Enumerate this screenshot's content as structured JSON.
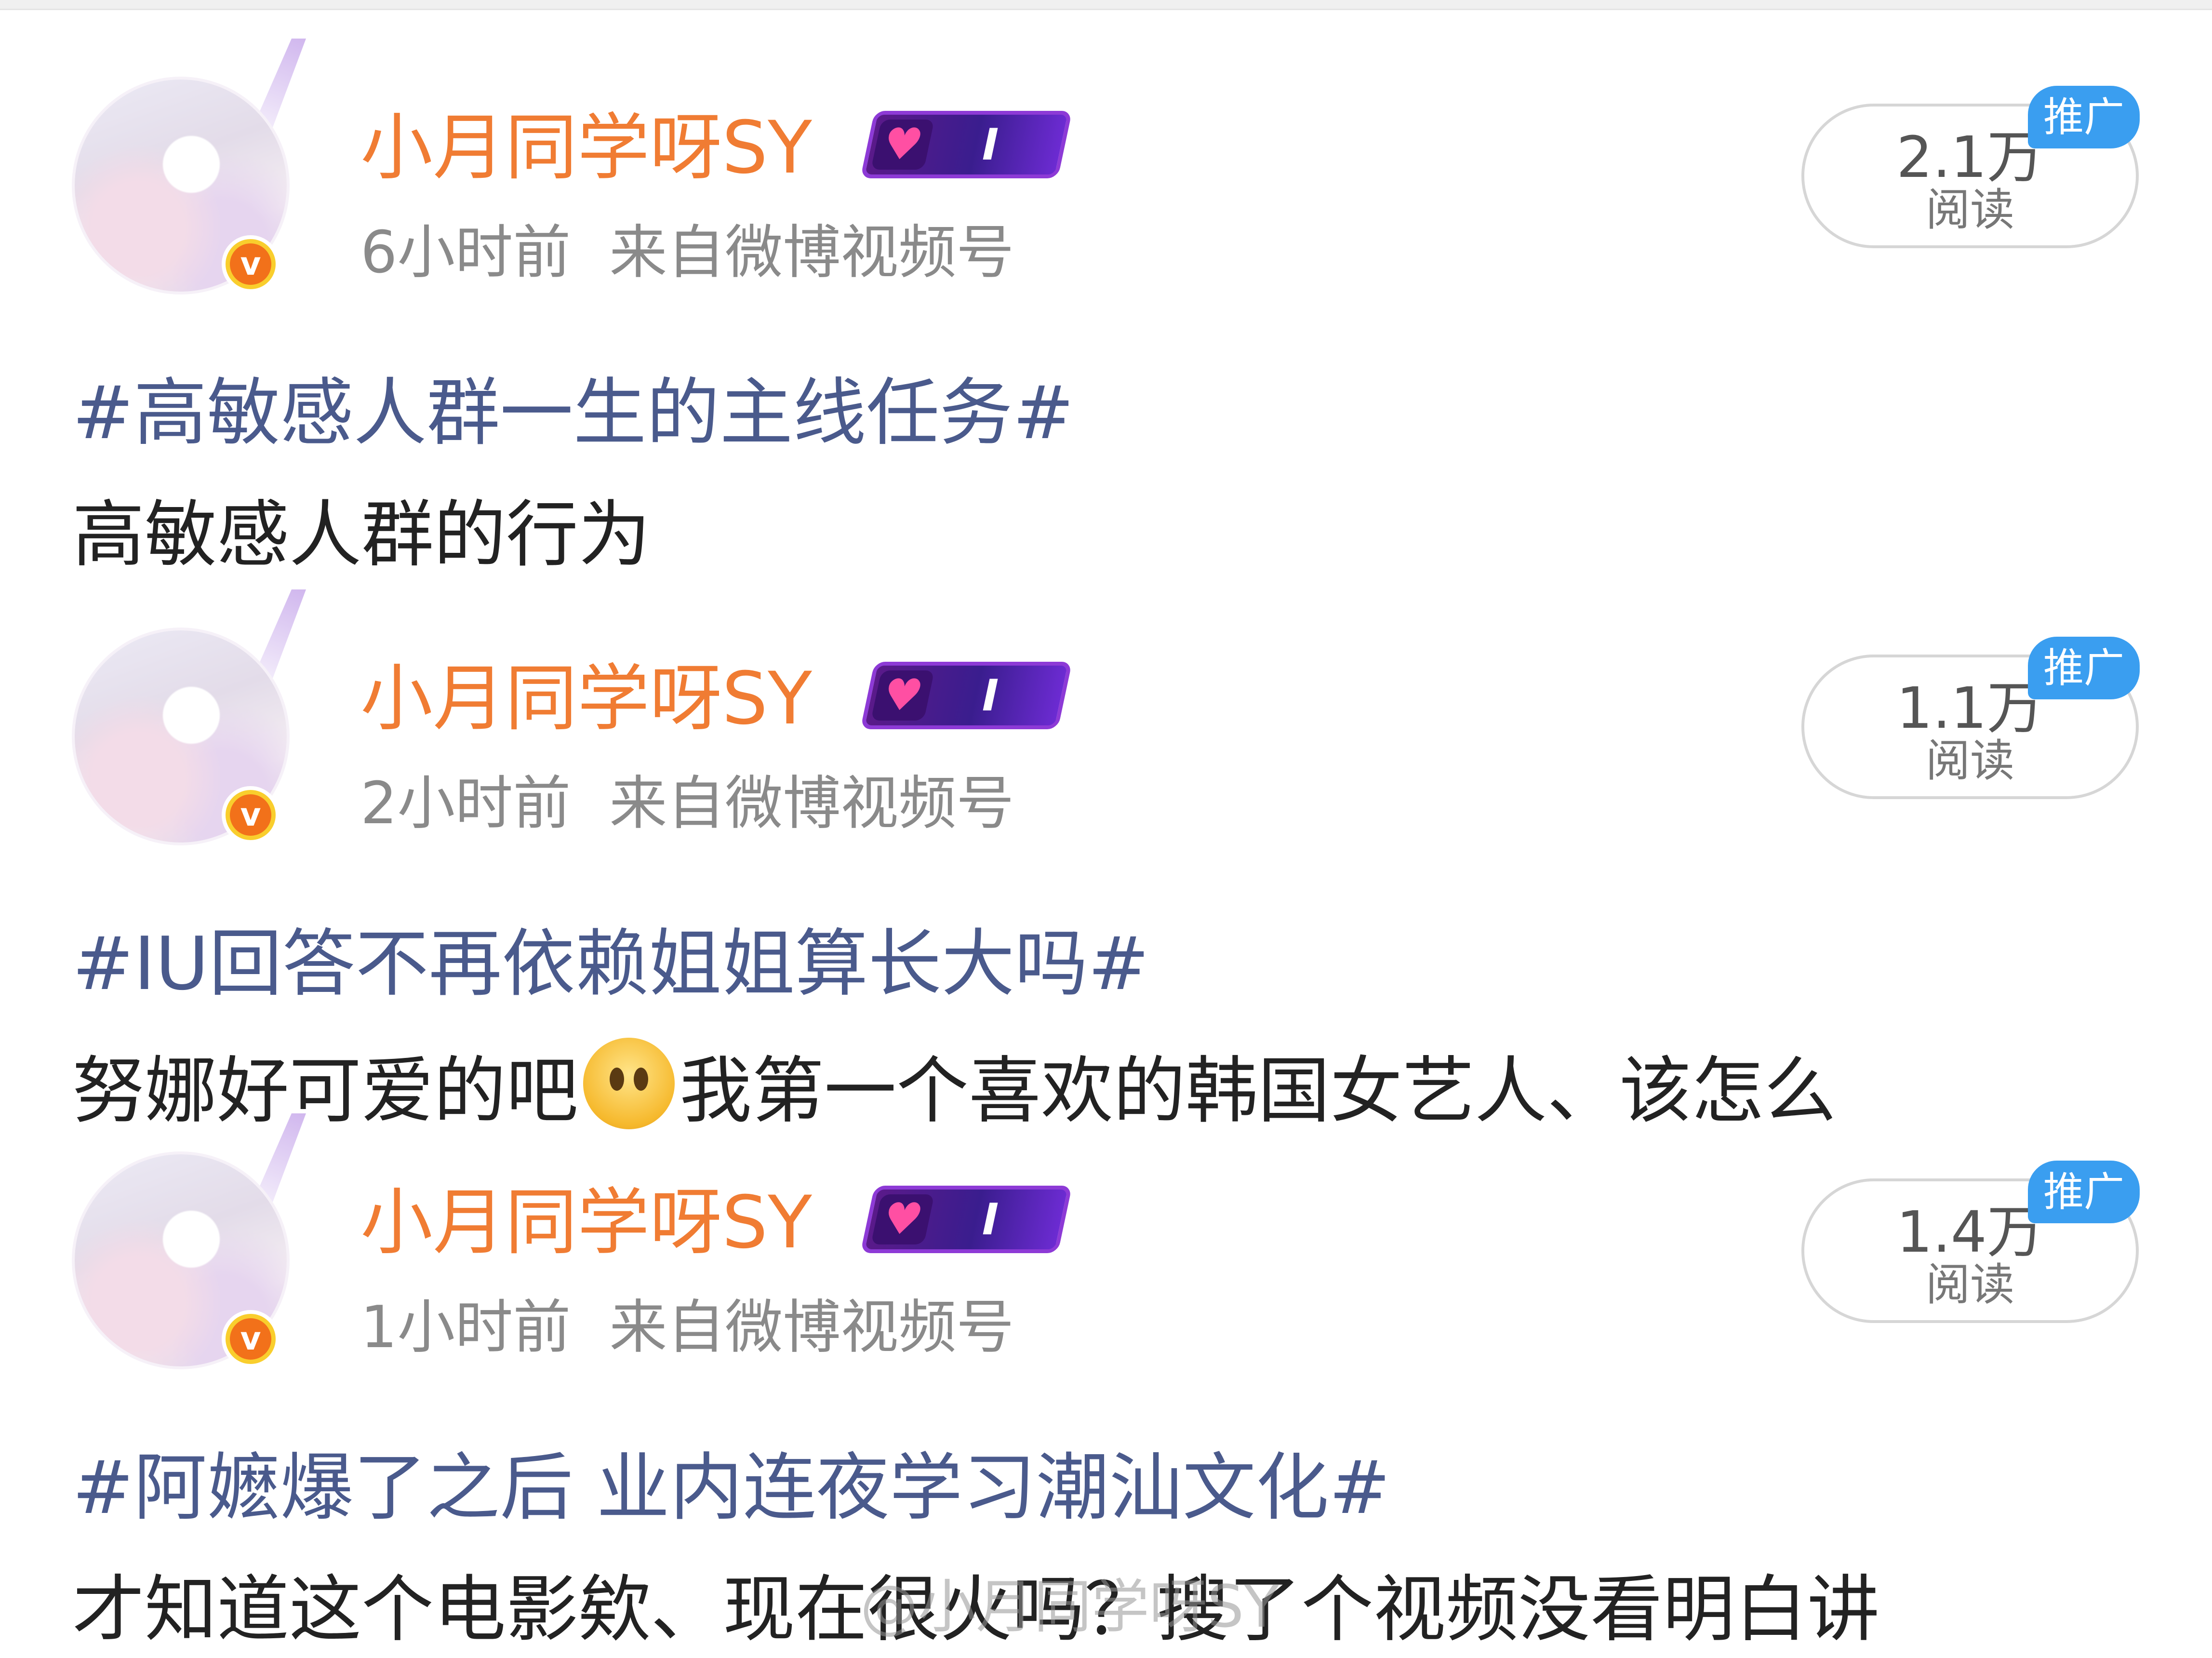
{
  "posts": [
    {
      "username": "小月同学呀SY",
      "fan_level": "I",
      "time": "6小时前",
      "source": "来自微博视频号",
      "views": "2.1万",
      "views_label": "阅读",
      "promo": "推广",
      "topic": "#高敏感人群一生的主线任务#",
      "body": "高敏感人群的行为",
      "body_after_emoji": ""
    },
    {
      "username": "小月同学呀SY",
      "fan_level": "I",
      "time": "2小时前",
      "source": "来自微博视频号",
      "views": "1.1万",
      "views_label": "阅读",
      "promo": "推广",
      "topic": "#IU回答不再依赖姐姐算长大吗#",
      "body": "努娜好可爱的吧",
      "body_emoji": "crying-face-emoji",
      "body_after_emoji": "我第一个喜欢的韩国女艺人、该怎么"
    },
    {
      "username": "小月同学呀SY",
      "fan_level": "I",
      "time": "1小时前",
      "source": "来自微博视频号",
      "views": "1.4万",
      "views_label": "阅读",
      "promo": "推广",
      "topic": "#阿嬷爆了之后 业内连夜学习潮汕文化#",
      "body": "才知道这个电影欸、现在很火吗？搜了个视频没看明白讲",
      "body_after_emoji": ""
    }
  ],
  "watermark": "@小月同学呀SY",
  "colors": {
    "username": "#f07c33",
    "topic": "#4a5a8c",
    "promo": "#3a9ef0",
    "meta": "#8a8a8a"
  }
}
